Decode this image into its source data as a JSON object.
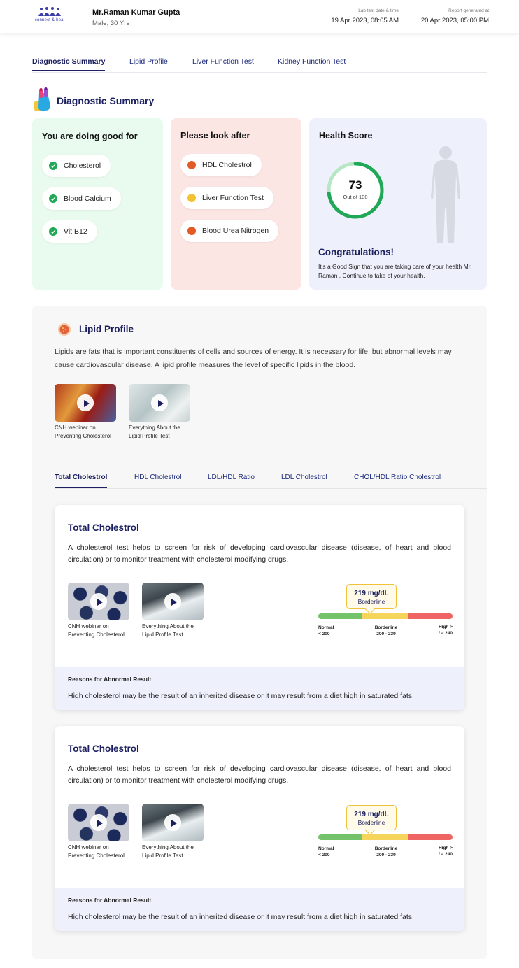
{
  "header": {
    "logo_text": "connect & heal",
    "patient_name": "Mr.Raman Kumar Gupta",
    "patient_info": "Male, 30 Yrs",
    "lab_label": "Lab test date & time",
    "lab_value": "19 Apr 2023, 08:05 AM",
    "report_label": "Report generated at",
    "report_value": "20 Apr 2023, 05:00 PM"
  },
  "tabs": [
    "Diagnostic Summary",
    "Lipid Profile",
    "Liver Function Test",
    "Kidney Function Test"
  ],
  "summary": {
    "title": "Diagnostic Summary",
    "good": {
      "heading": "You are doing good for",
      "items": [
        "Cholesterol",
        "Blood Calcium",
        "Vit B12"
      ]
    },
    "look": {
      "heading": "Please look after",
      "items": [
        "HDL Cholestrol",
        "Liver Function Test",
        "Blood Urea Nitrogen"
      ]
    },
    "health": {
      "heading": "Health Score",
      "score": "73",
      "score_sub": "Out of 100",
      "score_fraction": 0.73,
      "congrats": "Congratulations!",
      "message": "It's a Good Sign that you are taking care of your health Mr. Raman . Continue to take of your health."
    }
  },
  "lipid": {
    "title": "Lipid Profile",
    "description": "Lipids are fats that is important constituents of cells and sources of energy. It is necessary for life, but abnormal levels may cause cardiovascular disease. A lipid profile measures the level of specific lipids in the blood.",
    "videos": [
      {
        "caption": "CNH webinar on Preventing Cholesterol"
      },
      {
        "caption": "Everything About the Lipid Profile Test"
      }
    ],
    "subtabs": [
      "Total Cholestrol",
      "HDL Cholestrol",
      "LDL/HDL Ratio",
      "LDL Cholestrol",
      "CHOL/HDL Ratio Cholestrol"
    ]
  },
  "tests": [
    {
      "title": "Total Cholestrol",
      "description": "A cholesterol test helps to screen for risk of developing cardiovascular disease (disease, of heart and blood circulation) or to monitor treatment with cholesterol modifying drugs.",
      "videos": [
        {
          "caption": "CNH webinar on Preventing Cholesterol"
        },
        {
          "caption": "Everything About the Lipid Profile Test"
        }
      ],
      "value": "219 mg/dL",
      "status": "Borderline",
      "ranges": {
        "normal": "Normal",
        "normal_range": "< 200",
        "borderline": "Borderline",
        "borderline_range": "200 - 239",
        "high": "High >",
        "high_range": "/ = 240"
      },
      "reasons_label": "Reasons for Abnormal Result",
      "reasons_text": "High cholesterol may be the result of an inherited disease or it may result from a diet high in saturated fats."
    },
    {
      "title": "Total Cholestrol",
      "description": "A cholesterol test helps to screen for risk of developing cardiovascular disease (disease, of heart and blood circulation) or to monitor treatment with cholesterol modifying drugs.",
      "videos": [
        {
          "caption": "CNH webinar on Preventing Cholesterol"
        },
        {
          "caption": "Everything About the Lipid Profile Test"
        }
      ],
      "value": "219 mg/dL",
      "status": "Borderline",
      "ranges": {
        "normal": "Normal",
        "normal_range": "< 200",
        "borderline": "Borderline",
        "borderline_range": "200 - 239",
        "high": "High >",
        "high_range": "/ = 240"
      },
      "reasons_label": "Reasons for Abnormal Result",
      "reasons_text": "High cholesterol may be the result of an inherited disease or it may result from a diet high in saturated fats."
    }
  ],
  "colors": {
    "accent": "#1c2060",
    "good": "#1fa855",
    "warn": "#f2c230",
    "bad": "#e45a24"
  }
}
